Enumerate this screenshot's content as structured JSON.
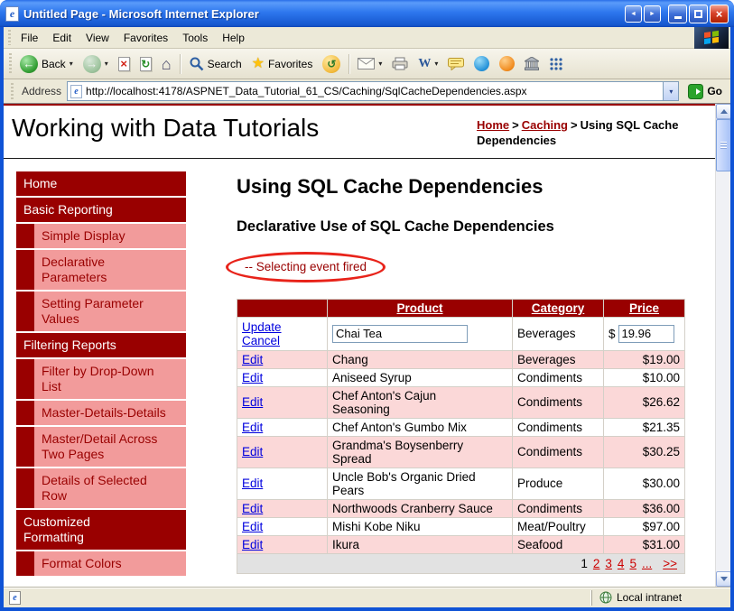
{
  "window": {
    "title": "Untitled Page - Microsoft Internet Explorer"
  },
  "menubar": {
    "items": [
      "File",
      "Edit",
      "View",
      "Favorites",
      "Tools",
      "Help"
    ]
  },
  "toolbar": {
    "back": "Back",
    "search": "Search",
    "favorites": "Favorites"
  },
  "addressbar": {
    "label": "Address",
    "url": "http://localhost:4178/ASPNET_Data_Tutorial_61_CS/Caching/SqlCacheDependencies.aspx",
    "go": "Go"
  },
  "statusbar": {
    "zone": "Local intranet"
  },
  "icons": {
    "back_arrow": "←",
    "forward_arrow": "→",
    "stop": "×",
    "refresh": "↻",
    "home": "⌂",
    "star": "★",
    "history": "↺",
    "word": "W",
    "dropdown": "▾",
    "close": "×",
    "left": "◄",
    "right": "►"
  },
  "colors": {
    "maroon": "#990000",
    "sidebar_pink": "#F29B9B",
    "alt_row_pink": "#FBD8D8",
    "annotation_red": "#E8231A",
    "link_blue": "#0000DE",
    "pager_red": "#CC0000"
  },
  "page": {
    "site_title": "Working with Data Tutorials",
    "breadcrumb": {
      "home": "Home",
      "section": "Caching",
      "separator": ">",
      "current": "Using SQL Cache Dependencies"
    },
    "sidebar": [
      {
        "label": "Home",
        "type": "section"
      },
      {
        "label": "Basic Reporting",
        "type": "section"
      },
      {
        "label": "Simple Display",
        "type": "sub"
      },
      {
        "label": "Declarative Parameters",
        "type": "sub"
      },
      {
        "label": "Setting Parameter Values",
        "type": "sub"
      },
      {
        "label": "Filtering Reports",
        "type": "section"
      },
      {
        "label": "Filter by Drop-Down List",
        "type": "sub"
      },
      {
        "label": "Master-Details-Details",
        "type": "sub"
      },
      {
        "label": "Master/Detail Across Two Pages",
        "type": "sub"
      },
      {
        "label": "Details of Selected Row",
        "type": "sub"
      },
      {
        "label": "Customized Formatting",
        "type": "section"
      },
      {
        "label": "Format Colors",
        "type": "sub"
      }
    ],
    "heading": "Using SQL Cache Dependencies",
    "subheading": "Declarative Use of SQL Cache Dependencies",
    "annotation": "-- Selecting event fired",
    "grid": {
      "headers": {
        "product": "Product",
        "category": "Category",
        "price": "Price"
      },
      "edit_row": {
        "update": "Update",
        "cancel": "Cancel",
        "product": "Chai Tea",
        "category": "Beverages",
        "currency": "$",
        "price": "19.96"
      },
      "row_action": "Edit",
      "rows": [
        {
          "product": "Chang",
          "category": "Beverages",
          "price": "$19.00"
        },
        {
          "product": "Aniseed Syrup",
          "category": "Condiments",
          "price": "$10.00"
        },
        {
          "product": "Chef Anton's Cajun Seasoning",
          "category": "Condiments",
          "price": "$26.62"
        },
        {
          "product": "Chef Anton's Gumbo Mix",
          "category": "Condiments",
          "price": "$21.35"
        },
        {
          "product": "Grandma's Boysenberry Spread",
          "category": "Condiments",
          "price": "$30.25"
        },
        {
          "product": "Uncle Bob's Organic Dried Pears",
          "category": "Produce",
          "price": "$30.00"
        },
        {
          "product": "Northwoods Cranberry Sauce",
          "category": "Condiments",
          "price": "$36.00"
        },
        {
          "product": "Mishi Kobe Niku",
          "category": "Meat/Poultry",
          "price": "$97.00"
        },
        {
          "product": "Ikura",
          "category": "Seafood",
          "price": "$31.00"
        }
      ],
      "pager": {
        "current": "1",
        "pages": [
          "2",
          "3",
          "4",
          "5",
          "..."
        ],
        "last": ">>"
      }
    }
  }
}
